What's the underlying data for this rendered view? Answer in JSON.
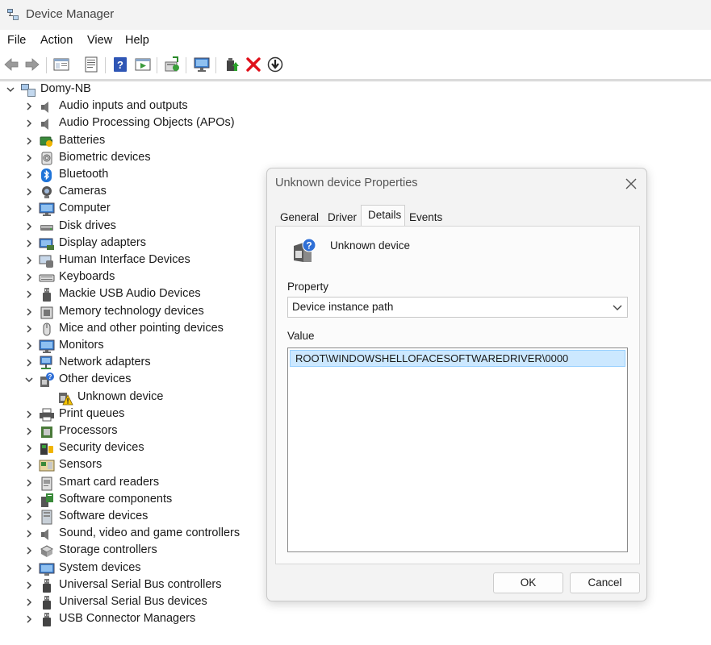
{
  "window": {
    "title": "Device Manager"
  },
  "menu": [
    "File",
    "Action",
    "View",
    "Help"
  ],
  "toolbar": {
    "icons": [
      "back-icon",
      "forward-icon",
      "show-hide-tree-icon",
      "properties-icon",
      "help-icon",
      "update-driver-toolbar-icon",
      "scan-hardware-icon",
      "monitor-icon",
      "enable-device-icon",
      "uninstall-device-icon",
      "disable-device-icon"
    ]
  },
  "tree": {
    "root": "Domy-NB",
    "categories": [
      {
        "label": "Audio inputs and outputs",
        "icon": "speaker-icon"
      },
      {
        "label": "Audio Processing Objects (APOs)",
        "icon": "speaker-icon"
      },
      {
        "label": "Batteries",
        "icon": "battery-icon"
      },
      {
        "label": "Biometric devices",
        "icon": "fingerprint-icon"
      },
      {
        "label": "Bluetooth",
        "icon": "bluetooth-icon"
      },
      {
        "label": "Cameras",
        "icon": "camera-icon"
      },
      {
        "label": "Computer",
        "icon": "computer-icon"
      },
      {
        "label": "Disk drives",
        "icon": "disk-drive-icon"
      },
      {
        "label": "Display adapters",
        "icon": "display-adapter-icon"
      },
      {
        "label": "Human Interface Devices",
        "icon": "hid-icon"
      },
      {
        "label": "Keyboards",
        "icon": "keyboard-icon"
      },
      {
        "label": "Mackie USB Audio Devices",
        "icon": "usb-audio-icon"
      },
      {
        "label": "Memory technology devices",
        "icon": "memory-icon"
      },
      {
        "label": "Mice and other pointing devices",
        "icon": "mouse-icon"
      },
      {
        "label": "Monitors",
        "icon": "monitor-icon"
      },
      {
        "label": "Network adapters",
        "icon": "network-icon"
      },
      {
        "label": "Other devices",
        "icon": "other-devices-icon",
        "expanded": true,
        "children": [
          {
            "label": "Unknown device",
            "icon": "warning-device-icon"
          }
        ]
      },
      {
        "label": "Print queues",
        "icon": "printer-icon"
      },
      {
        "label": "Processors",
        "icon": "processor-icon"
      },
      {
        "label": "Security devices",
        "icon": "security-device-icon"
      },
      {
        "label": "Sensors",
        "icon": "sensor-icon"
      },
      {
        "label": "Smart card readers",
        "icon": "smart-card-icon"
      },
      {
        "label": "Software components",
        "icon": "software-component-icon"
      },
      {
        "label": "Software devices",
        "icon": "software-device-icon"
      },
      {
        "label": "Sound, video and game controllers",
        "icon": "speaker-icon"
      },
      {
        "label": "Storage controllers",
        "icon": "storage-controller-icon"
      },
      {
        "label": "System devices",
        "icon": "system-device-icon"
      },
      {
        "label": "Universal Serial Bus controllers",
        "icon": "usb-icon"
      },
      {
        "label": "Universal Serial Bus devices",
        "icon": "usb-icon"
      },
      {
        "label": "USB Connector Managers",
        "icon": "usb-icon"
      }
    ]
  },
  "dialog": {
    "title": "Unknown device Properties",
    "tabs": [
      "General",
      "Driver",
      "Details",
      "Events"
    ],
    "active_tab": "Details",
    "device_name": "Unknown device",
    "property_label": "Property",
    "property_selected": "Device instance path",
    "value_label": "Value",
    "value_items": [
      "ROOT\\WINDOWSHELLOFACESOFTWAREDRIVER\\0000"
    ],
    "ok_label": "OK",
    "cancel_label": "Cancel"
  },
  "colors": {
    "selection": "#cce8ff",
    "selection_border": "#99d1ff",
    "warning": "#f5c400",
    "delete_red": "#e0101a",
    "accent_blue": "#1e73d8"
  }
}
